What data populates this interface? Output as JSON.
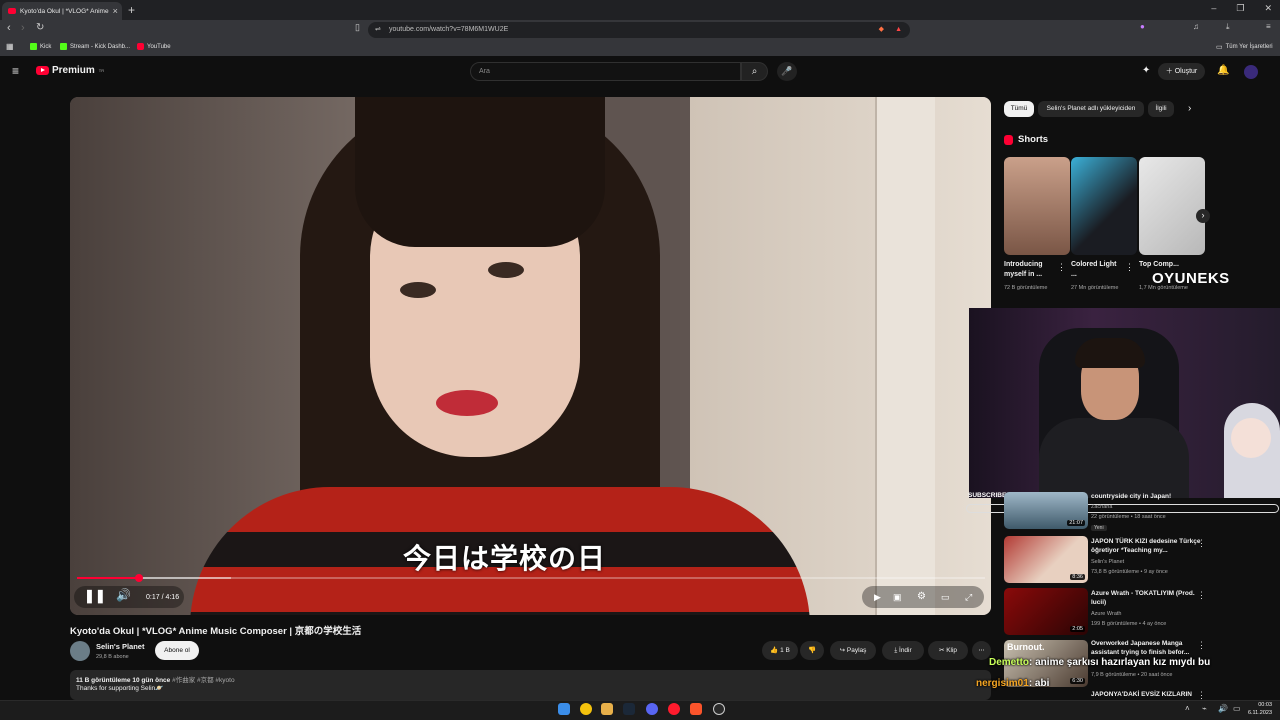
{
  "browser": {
    "tab_title": "Kyoto'da Okul | *VLOG* Anime",
    "tab_close": "×",
    "new_tab": "+",
    "url": "youtube.com/watch?v=78M6M1WU2E",
    "bookmarks": [
      "Kick",
      "Stream - Kick Dashb...",
      "YouTube"
    ],
    "bookmarks_folder": "Tüm Yer İşaretleri",
    "accent": "#ff0033"
  },
  "header": {
    "logo_text": "Premium",
    "logo_sup": "TR",
    "search_placeholder": "Ara",
    "create_label": "Oluştur"
  },
  "player": {
    "subtitle": "今日は学校の日",
    "time": "0:17 / 4:16",
    "progress_fraction": 0.068,
    "buffered_fraction": 0.17
  },
  "video": {
    "title": "Kyoto'da Okul | *VLOG* Anime Music Composer | 京都の学校生活",
    "channel": "Selin's Planet",
    "subscribers": "29,8 B abone",
    "subscribe_label": "Abone ol",
    "likes": "1 B",
    "share_label": "Paylaş",
    "download_label": "İndir",
    "clip_label": "Klip",
    "description_meta": "11 B görüntüleme  10 gün önce",
    "description_tags": "#作曲家 #京都 #kyoto",
    "description_text": "Thanks for supporting Selin🪐"
  },
  "sidebar": {
    "chips": [
      "Tümü",
      "Selin's Planet adlı yükleyiciden",
      "İlgili"
    ],
    "shorts_title": "Shorts",
    "shorts": [
      {
        "title": "Introducing myself in ...",
        "views": "72 B görüntüleme"
      },
      {
        "title": "Colored Light ...",
        "views": "27 Mn görüntüleme"
      },
      {
        "title": "Top Comp...",
        "views": "1,7 Mn görüntüleme"
      }
    ],
    "related": [
      {
        "title": "countryside city in Japan!",
        "channel": "Zachana",
        "meta": "22 görüntüleme • 18 saat önce",
        "duration": "21:07",
        "badge": "Yeni"
      },
      {
        "title": "JAPON TÜRK KIZI dedesine Türkçe öğretiyor *Teaching my...",
        "channel": "Selin's Planet",
        "meta": "73,8 B görüntüleme • 9 ay önce",
        "duration": "8:36"
      },
      {
        "title": "Azure Wrath - TOKATLIYIM (Prod. lucii)",
        "channel": "Azure Wrath",
        "meta": "199 B görüntüleme • 4 ay önce",
        "duration": "2:05"
      },
      {
        "title": "Overworked Japanese Manga assistant trying to finish befor...",
        "channel": "",
        "meta": "7,9 B görüntüleme • 20 saat önce",
        "duration": "6:30",
        "thumb_text": "Burnout."
      },
      {
        "title": "JAPONYA'DAKİ EVSİZ KIZLARIN",
        "channel": "",
        "meta": "",
        "duration": ""
      }
    ]
  },
  "overlay": {
    "brand": "OYUNEKS",
    "subscribe_bar_label": "SUBSCRIBER",
    "chat": [
      {
        "user": "Demetto",
        "message": ": anime şarkısı hazırlayan kız mıydı bu"
      },
      {
        "user": "nergisim01",
        "message": ": abi"
      }
    ]
  },
  "taskbar": {
    "time": "00:03",
    "date": "6.11.2023"
  }
}
